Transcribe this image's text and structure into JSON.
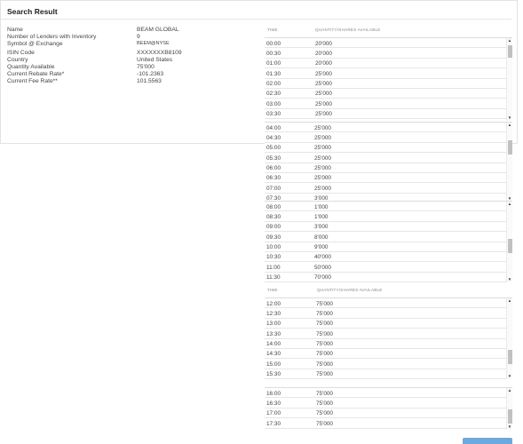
{
  "card": {
    "title": "Search Result"
  },
  "info": [
    {
      "label": "Name",
      "value": "BEAM GLOBAL",
      "small": false
    },
    {
      "label": "Number of Lenders with Inventory",
      "value": "9",
      "small": false
    },
    {
      "label": "Symbol @ Exchange",
      "value": "BEEM@NYSE",
      "small": true
    },
    {
      "label": "ISIN Code",
      "value": "XXXXXXXB8109",
      "small": false,
      "gap": true
    },
    {
      "label": "Country",
      "value": "United States",
      "small": false
    },
    {
      "label": "Quantity Available",
      "value": "75'000",
      "small": false
    },
    {
      "label": "Current Rebate Rate*",
      "value": "-101.2363",
      "small": false
    },
    {
      "label": "Current Fee Rate**",
      "value": "101.5563",
      "small": false
    }
  ],
  "grid": {
    "col_time": "TIME",
    "col_qty": "QUANTITY/SHARES AVAILABLE",
    "panels": [
      {
        "rows": [
          [
            "00:00",
            "20'000"
          ],
          [
            "00:30",
            "20'000"
          ],
          [
            "01:00",
            "20'000"
          ],
          [
            "01:30",
            "25'000"
          ],
          [
            "02:00",
            "25'000"
          ],
          [
            "02:30",
            "25'000"
          ],
          [
            "03:00",
            "25'000"
          ],
          [
            "03:30",
            "25'000"
          ]
        ]
      },
      {
        "rows": [
          [
            "04:00",
            "25'000"
          ],
          [
            "04:30",
            "25'000"
          ],
          [
            "05:00",
            "25'000"
          ],
          [
            "05:30",
            "25'000"
          ],
          [
            "06:00",
            "25'000"
          ],
          [
            "06:30",
            "25'000"
          ],
          [
            "07:00",
            "25'000"
          ],
          [
            "07:30",
            "3'000"
          ]
        ]
      },
      {
        "rows": [
          [
            "08:00",
            "1'000"
          ],
          [
            "08:30",
            "1'000"
          ],
          [
            "09:00",
            "3'000"
          ],
          [
            "09:30",
            "8'000"
          ],
          [
            "10:00",
            "9'000"
          ],
          [
            "10:30",
            "40'000"
          ],
          [
            "11:00",
            "50'000"
          ],
          [
            "11:30",
            "70'000"
          ]
        ]
      },
      {
        "rows": [
          [
            "12:00",
            "75'000"
          ],
          [
            "12:30",
            "75'000"
          ],
          [
            "13:00",
            "75'000"
          ],
          [
            "13:30",
            "75'000"
          ],
          [
            "14:00",
            "75'000"
          ],
          [
            "14:30",
            "75'000"
          ],
          [
            "15:00",
            "75'000"
          ],
          [
            "15:30",
            "75'000"
          ]
        ]
      },
      {
        "rows": [
          [
            "16:00",
            "75'000"
          ],
          [
            "16:30",
            "75'000"
          ],
          [
            "17:00",
            "75'000"
          ],
          [
            "17:30",
            "75'000"
          ]
        ]
      }
    ]
  },
  "icons": {
    "scroll_up": "scroll-up-arrow-icon",
    "scroll_down": "scroll-down-arrow-icon"
  }
}
